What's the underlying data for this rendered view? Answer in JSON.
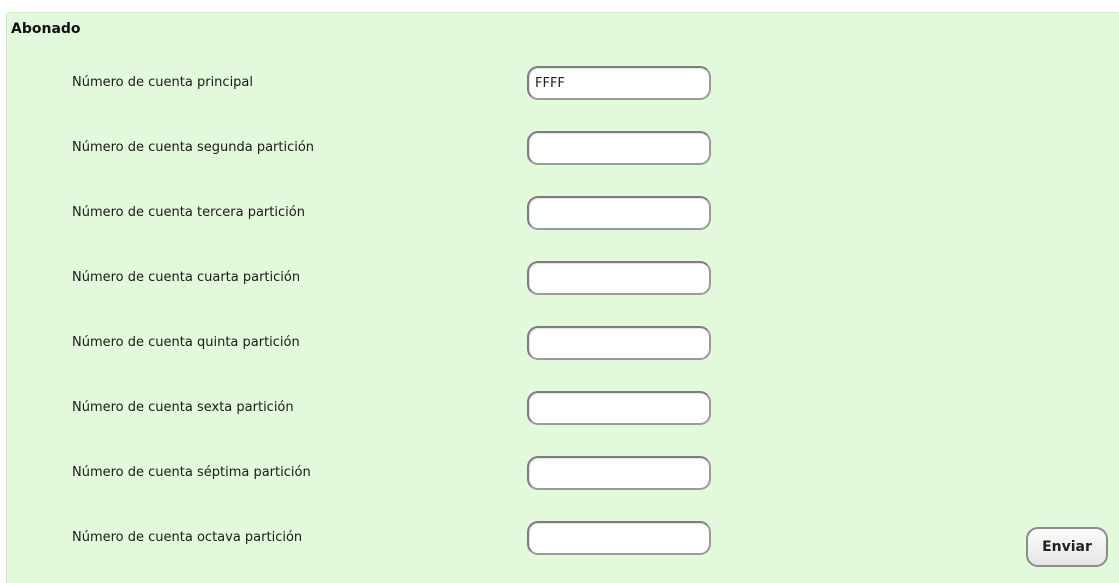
{
  "section": {
    "title": "Abonado"
  },
  "fields": [
    {
      "label": "Número de cuenta principal",
      "value": "FFFF",
      "placeholder": ""
    },
    {
      "label": "Número de cuenta segunda partición",
      "value": "",
      "placeholder": ""
    },
    {
      "label": "Número de cuenta tercera partición",
      "value": "",
      "placeholder": ""
    },
    {
      "label": "Número de cuenta cuarta partición",
      "value": "",
      "placeholder": ""
    },
    {
      "label": "Número de cuenta quinta partición",
      "value": "",
      "placeholder": ""
    },
    {
      "label": "Número de cuenta sexta partición",
      "value": "",
      "placeholder": ""
    },
    {
      "label": "Número de cuenta séptima partición",
      "value": "",
      "placeholder": ""
    },
    {
      "label": "Número de cuenta octava partición",
      "value": "",
      "placeholder": ""
    }
  ],
  "actions": {
    "submit_label": "Enviar"
  }
}
